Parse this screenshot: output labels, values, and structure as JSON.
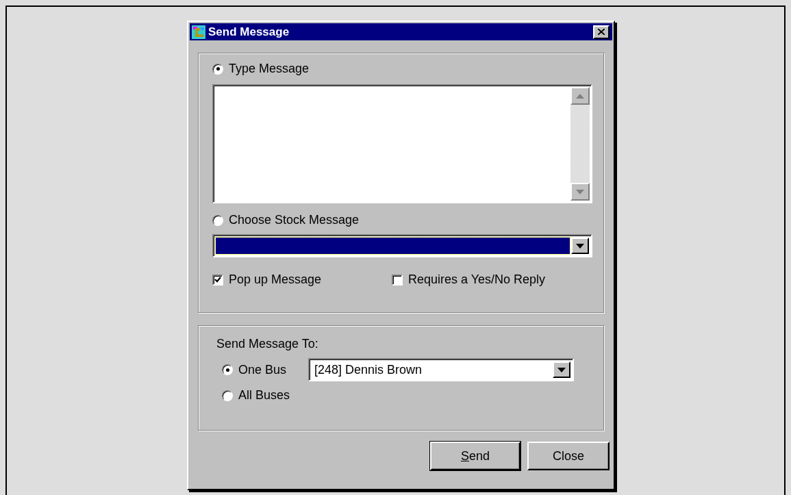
{
  "window": {
    "title": "Send Message"
  },
  "message_group": {
    "options": [
      {
        "label": "Type Message",
        "selected": true
      },
      {
        "label": "Choose Stock Message",
        "selected": false
      }
    ],
    "stock_select": {
      "focused": true
    },
    "checkboxes": [
      {
        "label": "Pop up Message",
        "checked": true
      },
      {
        "label": "Requires a Yes/No Reply",
        "checked": false
      }
    ]
  },
  "recipient_group": {
    "label": "Send Message To:",
    "options": [
      {
        "label": "One Bus",
        "selected": true
      },
      {
        "label": "All Buses",
        "selected": false
      }
    ],
    "bus_select": {
      "value": "[248] Dennis Brown"
    }
  },
  "buttons": [
    {
      "label": "Send",
      "mnemonic": true
    },
    {
      "label": "Close",
      "mnemonic": false
    }
  ]
}
